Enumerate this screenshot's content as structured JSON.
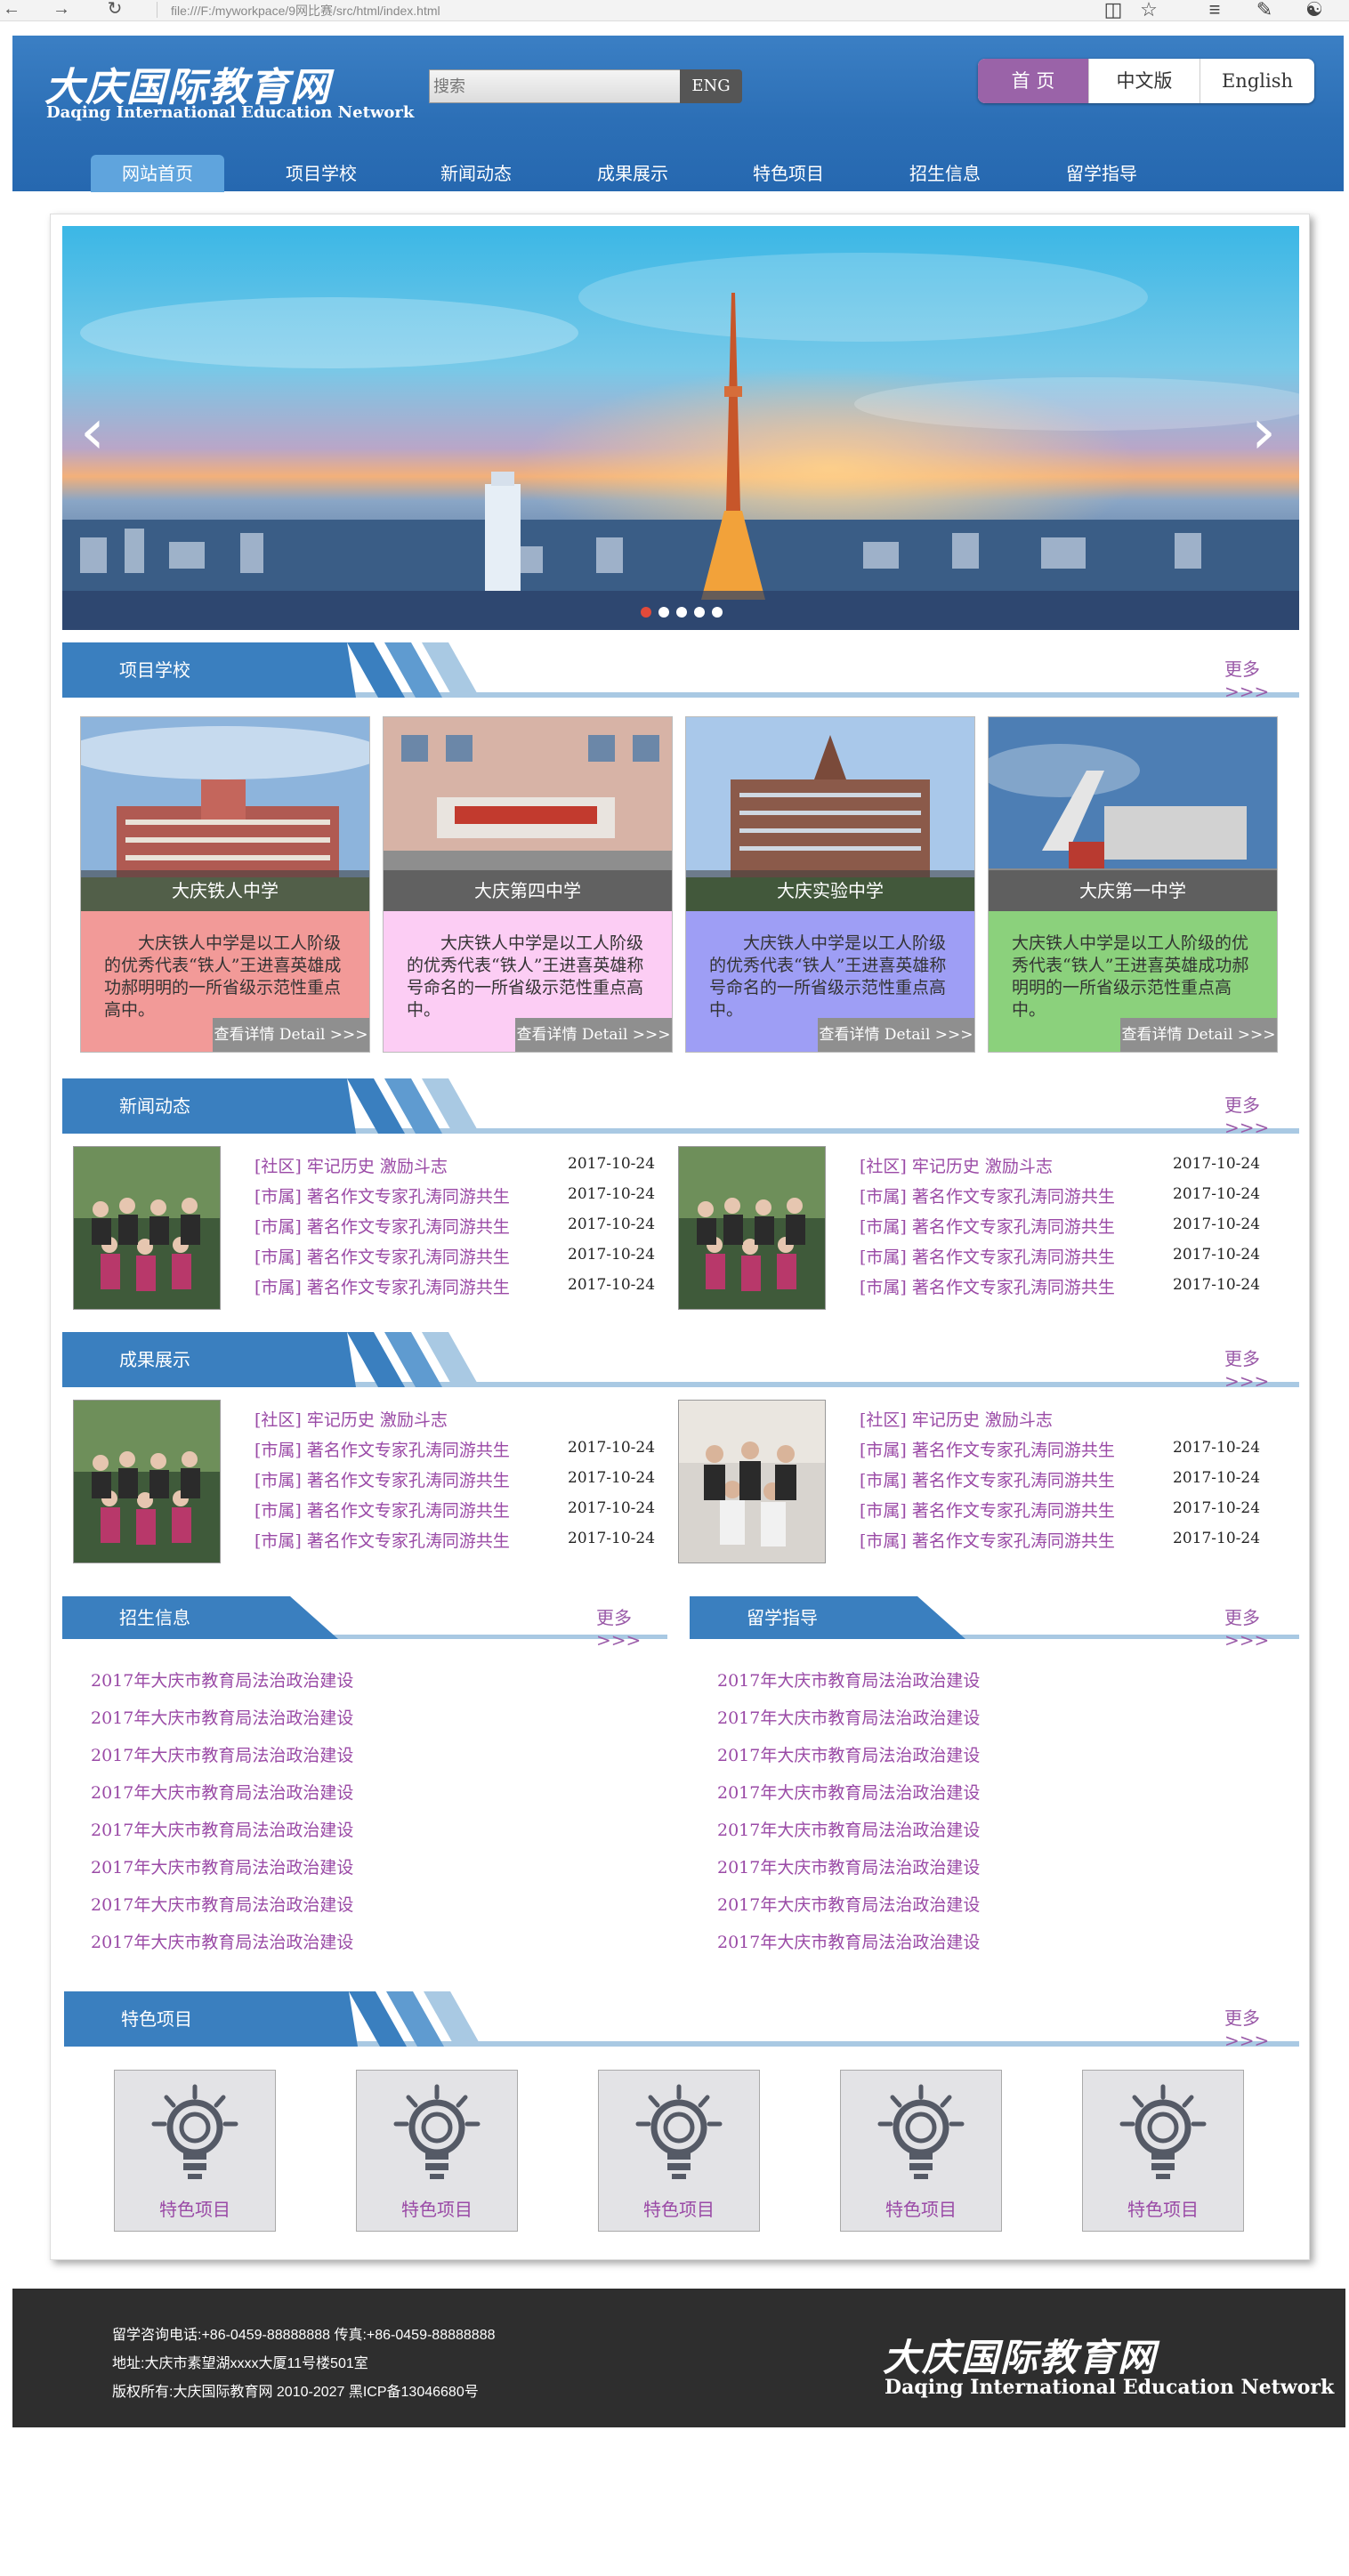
{
  "browser": {
    "url": "file:///F:/myworkpace/9网比赛/src/html/index.html"
  },
  "header": {
    "logo_cn": "大庆国际教育网",
    "logo_en": "Daqing International Education Network",
    "search_placeholder": "搜索",
    "search_button": "ENG",
    "lang": [
      "首 页",
      "中文版",
      "English"
    ],
    "menu": [
      "网站首页",
      "项目学校",
      "新闻动态",
      "成果展示",
      "特色项目",
      "招生信息",
      "留学指导"
    ]
  },
  "sections": {
    "schools": "项目学校",
    "news": "新闻动态",
    "results": "成果展示",
    "enroll": "招生信息",
    "study": "留学指导",
    "features": "特色项目",
    "more": "更多 >>>"
  },
  "schools": [
    {
      "name": "大庆铁人中学",
      "desc": "大庆铁人中学是以工人阶级的优秀代表“铁人”王进喜英雄成功郝明明的一所省级示范性重点高中。",
      "color": "#f29a98"
    },
    {
      "name": "大庆第四中学",
      "desc": "大庆铁人中学是以工人阶级的优秀代表“铁人”王进喜英雄称号命名的一所省级示范性重点高中。",
      "color": "#fccdf4"
    },
    {
      "name": "大庆实验中学",
      "desc": "大庆铁人中学是以工人阶级的优秀代表“铁人”王进喜英雄称号命名的一所省级示范性重点高中。",
      "color": "#9e9ef5"
    },
    {
      "name": "大庆第一中学",
      "desc": "大庆铁人中学是以工人阶级的优秀代表“铁人”王进喜英雄成功郝明明的一所省级示范性重点高中。",
      "color": "#8bd17c"
    }
  ],
  "detail_label": "查看详情 Detail >>>",
  "news_left": [
    {
      "title": "[社区] 牢记历史 激励斗志",
      "date": "2017-10-24"
    },
    {
      "title": "[市属] 著名作文专家孔涛同游共生",
      "date": "2017-10-24"
    },
    {
      "title": "[市属] 著名作文专家孔涛同游共生",
      "date": "2017-10-24"
    },
    {
      "title": "[市属] 著名作文专家孔涛同游共生",
      "date": "2017-10-24"
    },
    {
      "title": "[市属] 著名作文专家孔涛同游共生",
      "date": "2017-10-24"
    }
  ],
  "news_right": [
    {
      "title": "[社区] 牢记历史 激励斗志",
      "date": "2017-10-24"
    },
    {
      "title": "[市属] 著名作文专家孔涛同游共生",
      "date": "2017-10-24"
    },
    {
      "title": "[市属] 著名作文专家孔涛同游共生",
      "date": "2017-10-24"
    },
    {
      "title": "[市属] 著名作文专家孔涛同游共生",
      "date": "2017-10-24"
    },
    {
      "title": "[市属] 著名作文专家孔涛同游共生",
      "date": "2017-10-24"
    }
  ],
  "results_left": [
    {
      "title": "[社区] 牢记历史 激励斗志",
      "date": ""
    },
    {
      "title": "[市属] 著名作文专家孔涛同游共生",
      "date": "2017-10-24"
    },
    {
      "title": "[市属] 著名作文专家孔涛同游共生",
      "date": "2017-10-24"
    },
    {
      "title": "[市属] 著名作文专家孔涛同游共生",
      "date": "2017-10-24"
    },
    {
      "title": "[市属] 著名作文专家孔涛同游共生",
      "date": "2017-10-24"
    }
  ],
  "results_right": [
    {
      "title": "[社区] 牢记历史 激励斗志",
      "date": ""
    },
    {
      "title": "[市属] 著名作文专家孔涛同游共生",
      "date": "2017-10-24"
    },
    {
      "title": "[市属] 著名作文专家孔涛同游共生",
      "date": "2017-10-24"
    },
    {
      "title": "[市属] 著名作文专家孔涛同游共生",
      "date": "2017-10-24"
    },
    {
      "title": "[市属] 著名作文专家孔涛同游共生",
      "date": "2017-10-24"
    }
  ],
  "enroll_links": [
    "2017年大庆市教育局法治政治建设",
    "2017年大庆市教育局法治政治建设",
    "2017年大庆市教育局法治政治建设",
    "2017年大庆市教育局法治政治建设",
    "2017年大庆市教育局法治政治建设",
    "2017年大庆市教育局法治政治建设",
    "2017年大庆市教育局法治政治建设",
    "2017年大庆市教育局法治政治建设"
  ],
  "study_links": [
    "2017年大庆市教育局法治政治建设",
    "2017年大庆市教育局法治政治建设",
    "2017年大庆市教育局法治政治建设",
    "2017年大庆市教育局法治政治建设",
    "2017年大庆市教育局法治政治建设",
    "2017年大庆市教育局法治政治建设",
    "2017年大庆市教育局法治政治建设",
    "2017年大庆市教育局法治政治建设"
  ],
  "features": [
    "特色项目",
    "特色项目",
    "特色项目",
    "特色项目",
    "特色项目"
  ],
  "footer": {
    "line1": "留学咨询电话:+86-0459-88888888 传真:+86-0459-88888888",
    "line2": "地址:大庆市素望湖xxxx大厦11号楼501室",
    "line3": "版权所有:大庆国际教育网 2010-2027 黑ICP备13046680号",
    "logo_cn": "大庆国际教育网",
    "logo_en": "Daqing International Education Network"
  },
  "colors": {
    "header_blue": "#2c6fb6",
    "tab_blue": "#3a7fbf",
    "link_purple": "#9a4aa6",
    "active_lang": "#9a63a8"
  }
}
